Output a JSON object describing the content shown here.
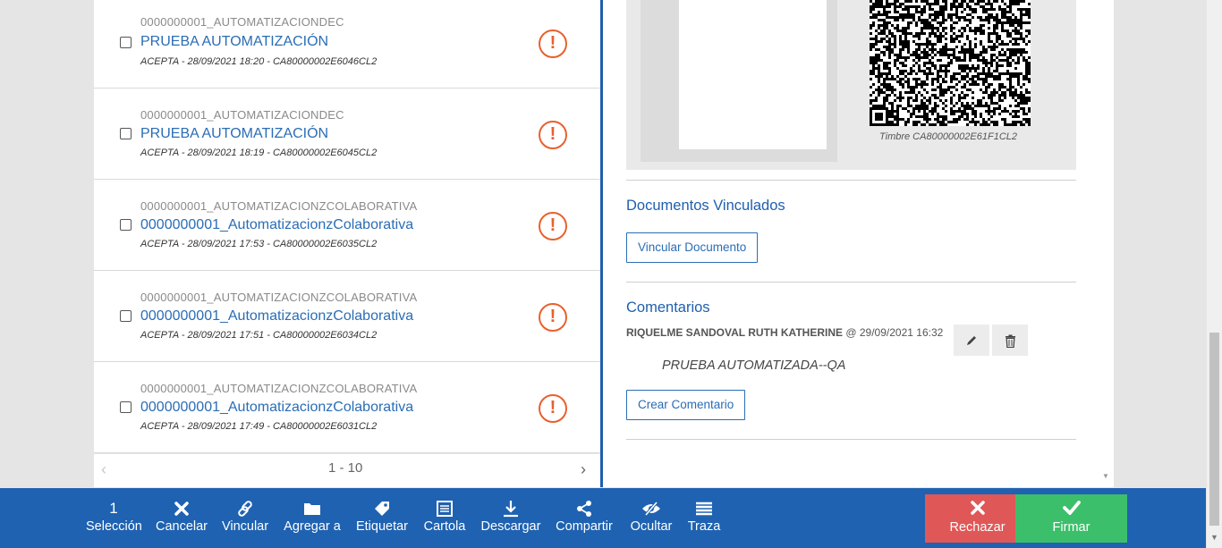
{
  "documents": [
    {
      "code": "0000000001_AUTOMATIZACIONDEC",
      "title": "PRUEBA AUTOMATIZACIÓN",
      "meta": "ACEPTA - 28/09/2021 18:20 - CA80000002E6046CL2",
      "status_icon": "alert-circle-icon"
    },
    {
      "code": "0000000001_AUTOMATIZACIONDEC",
      "title": "PRUEBA AUTOMATIZACIÓN",
      "meta": "ACEPTA - 28/09/2021 18:19 - CA80000002E6045CL2",
      "status_icon": "alert-circle-icon"
    },
    {
      "code": "0000000001_AUTOMATIZACIONZCOLABORATIVA",
      "title": "0000000001_AutomatizacionzColaborativa",
      "meta": "ACEPTA - 28/09/2021 17:53 - CA80000002E6035CL2",
      "status_icon": "alert-circle-icon"
    },
    {
      "code": "0000000001_AUTOMATIZACIONZCOLABORATIVA",
      "title": "0000000001_AutomatizacionzColaborativa",
      "meta": "ACEPTA - 28/09/2021 17:51 - CA80000002E6034CL2",
      "status_icon": "alert-circle-icon"
    },
    {
      "code": "0000000001_AUTOMATIZACIONZCOLABORATIVA",
      "title": "0000000001_AutomatizacionzColaborativa",
      "meta": "ACEPTA - 28/09/2021 17:49 - CA80000002E6031CL2",
      "status_icon": "alert-circle-icon"
    }
  ],
  "pager": {
    "range": "1 - 10",
    "prev": "‹",
    "next": "›"
  },
  "preview": {
    "timbre": "Timbre CA80000002E61F1CL2"
  },
  "linked": {
    "title": "Documentos Vinculados",
    "button": "Vincular Documento"
  },
  "comments": {
    "title": "Comentarios",
    "author": "RIQUELME SANDOVAL RUTH KATHERINE",
    "at": "@ 29/09/2021 16:32",
    "text": "PRUEBA AUTOMATIZADA--QA",
    "create_button": "Crear Comentario"
  },
  "toolbar": {
    "selection_count": "1",
    "items": [
      {
        "label": "Selección",
        "icon": "count"
      },
      {
        "label": "Cancelar",
        "icon": "close-icon"
      },
      {
        "label": "Vincular",
        "icon": "link-icon"
      },
      {
        "label": "Agregar a",
        "icon": "folder-icon"
      },
      {
        "label": "Etiquetar",
        "icon": "tag-icon"
      },
      {
        "label": "Cartola",
        "icon": "document-list-icon"
      },
      {
        "label": "Descargar",
        "icon": "download-icon"
      },
      {
        "label": "Compartir",
        "icon": "share-icon"
      },
      {
        "label": "Ocultar",
        "icon": "eye-slash-icon"
      },
      {
        "label": "Traza",
        "icon": "list-icon"
      }
    ],
    "reject_label": "Rechazar",
    "sign_label": "Firmar"
  },
  "colors": {
    "primary": "#1f62b1",
    "link": "#2a6db5",
    "alert": "#e8602c",
    "reject": "#e05757",
    "sign": "#3cbf6b"
  }
}
